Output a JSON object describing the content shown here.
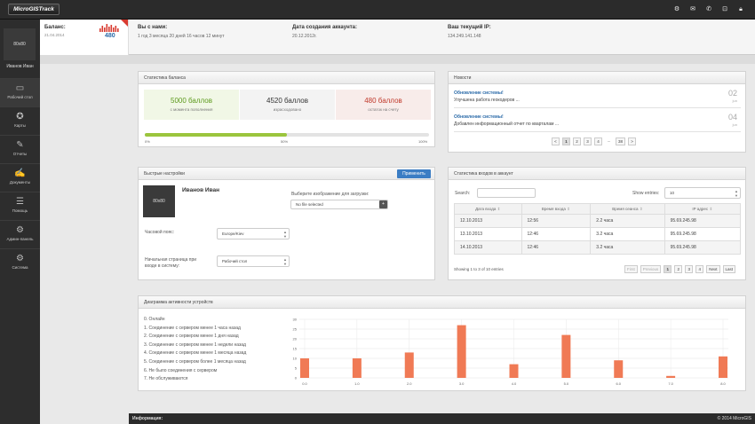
{
  "app": {
    "logo": "MicroGISTrack"
  },
  "topbar_icons": [
    "settings-icon",
    "mail-icon",
    "phone-icon",
    "lock-icon",
    "padlock-icon"
  ],
  "sidebar": {
    "avatar": "80x80",
    "user_name": "Иванов Иван",
    "items": [
      {
        "label": "Рабочий стол",
        "icon": "monitor-icon"
      },
      {
        "label": "Карты",
        "icon": "compass-icon"
      },
      {
        "label": "Отчеты",
        "icon": "reports-icon"
      },
      {
        "label": "Документы",
        "icon": "documents-icon"
      },
      {
        "label": "Помощь",
        "icon": "help-icon"
      },
      {
        "label": "Админ-панель",
        "icon": "admin-gear-icon"
      },
      {
        "label": "Система",
        "icon": "system-gear-icon"
      }
    ]
  },
  "infobar": {
    "balance_title": "Баланс:",
    "balance_date": "21.04.2014",
    "balance_value": "480",
    "with_us_title": "Вы с нами:",
    "with_us_value": "1 год 3 месяца 20 дней 16 часов 12 минут",
    "created_title": "Дата создания аккаунта:",
    "created_value": "20.12.2012г.",
    "ip_title": "Ваш текущий IP:",
    "ip_value": "134.249.141.148",
    "accent_color": "#d83b30"
  },
  "balance_stats": {
    "title": "Статистика баланса",
    "items": [
      {
        "value": "5000 баллов",
        "caption": "с момента пополнения",
        "color": "#5c9a1c"
      },
      {
        "value": "4520 баллов",
        "caption": "израсходовано",
        "color": "#333333"
      },
      {
        "value": "480 баллов",
        "caption": "остаток на счету",
        "color": "#c0392b"
      }
    ],
    "progress_fraction": 0.5,
    "progress_labels": [
      "0%",
      "50%",
      "100%"
    ]
  },
  "news": {
    "title": "Новости",
    "items": [
      {
        "title": "Обновление системы!",
        "text": "Улучшена работа геокодеров ...",
        "day": "02",
        "month": "jun"
      },
      {
        "title": "Обновление системы!",
        "text": "Добавлен информационный отчет по кварталам ...",
        "day": "04",
        "month": "jun"
      }
    ],
    "pager": [
      "<",
      "1",
      "2",
      "3",
      "4",
      "...",
      "38",
      ">"
    ]
  },
  "quick_settings": {
    "title": "Быстрые настройки",
    "apply_label": "Применить",
    "avatar": "80x80",
    "user_name": "Иванов Иван",
    "upload_label": "Выберите изображение для загрузки:",
    "file_placeholder": "No file selected",
    "upload_btn": "+",
    "tz_label": "Часовой пояс:",
    "tz_value": "Europe/Kiev",
    "start_label": "Начальная страница при входе в систему:",
    "start_value": "Рабочий стол"
  },
  "login_stats": {
    "title": "Статистика входов в аккаунт",
    "search_label": "Search:",
    "search_value": "",
    "show_label": "Show entries:",
    "show_value": "10",
    "columns": [
      "Дата входа",
      "Время входа",
      "Время сеанса",
      "IP адрес"
    ],
    "rows": [
      [
        "12.10.2013",
        "12:56",
        "2.2 часа",
        "95.69.245.98"
      ],
      [
        "13.10.2013",
        "12:46",
        "3.2 часа",
        "95.69.245.98"
      ],
      [
        "14.10.2013",
        "12:46",
        "3.2 часа",
        "95.69.245.98"
      ]
    ],
    "info": "Showing 1 to 3 of 10 entries",
    "pager": [
      "First",
      "Previous",
      "1",
      "2",
      "3",
      "4",
      "Next",
      "Last"
    ]
  },
  "activity": {
    "title": "Диаграмма активности устройств",
    "legend": [
      "0. Онлайн",
      "1. Соединение с сервером менее 1 часа назад",
      "2. Соединение с сервером менее 1 дня назад",
      "3. Соединение с сервером менее 1 недели назад",
      "4. Соединение с сервером менее 1 месяца назад",
      "5. Соединение с сервером более 1 месяца назад",
      "6. Не было соединения с сервером",
      "7. Не обслуживаются"
    ]
  },
  "chart_data": {
    "type": "bar",
    "x": [
      0,
      1,
      2,
      3,
      4,
      5,
      6,
      7,
      8
    ],
    "values": [
      10,
      10,
      13,
      27,
      7,
      22,
      9,
      1,
      11
    ],
    "xticks": [
      "0.0",
      "1.0",
      "2.0",
      "3.0",
      "4.0",
      "5.0",
      "6.0",
      "7.0",
      "8.0"
    ],
    "yticks": [
      0,
      5,
      10,
      15,
      20,
      25,
      30
    ],
    "ylim": [
      0,
      30
    ],
    "grid": true,
    "bar_color": "#f07a55"
  },
  "footer": {
    "left": "Информация:",
    "right": "© 2014 MicroGIS"
  }
}
